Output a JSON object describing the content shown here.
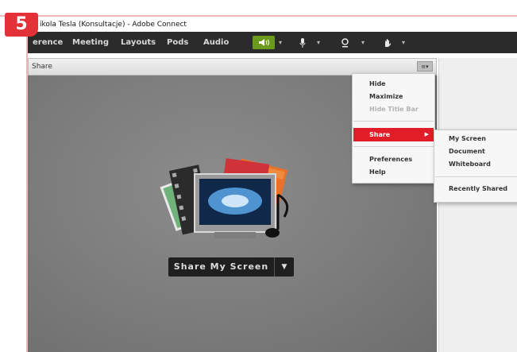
{
  "step": {
    "number": "5"
  },
  "window": {
    "title": "ikola Tesla (Konsultacje) - Adobe Connect"
  },
  "menubar": {
    "items": [
      "erence",
      "Meeting",
      "Layouts",
      "Pods",
      "Audio"
    ],
    "toolbar_icons": [
      "speaker-icon",
      "microphone-icon",
      "webcam-icon",
      "raise-hand-icon"
    ]
  },
  "pod": {
    "title": "Share",
    "menu_button": "≡▾"
  },
  "share_button": {
    "label": "Share My Screen",
    "arrow": "▼"
  },
  "pod_menu": {
    "items": [
      {
        "label": "Hide",
        "enabled": true
      },
      {
        "label": "Maximize",
        "enabled": true
      },
      {
        "label": "Hide Title Bar",
        "enabled": false
      },
      {
        "label": "Share",
        "highlighted": true
      },
      {
        "label": "Preferences",
        "enabled": true
      },
      {
        "label": "Help",
        "enabled": true
      }
    ]
  },
  "share_submenu": {
    "items": [
      "My Screen",
      "Document",
      "Whiteboard",
      "Recently Shared"
    ]
  },
  "colors": {
    "accent": "#e11d27",
    "toolbar_green": "#6c9a1c",
    "menubar": "#2b2b2b"
  }
}
